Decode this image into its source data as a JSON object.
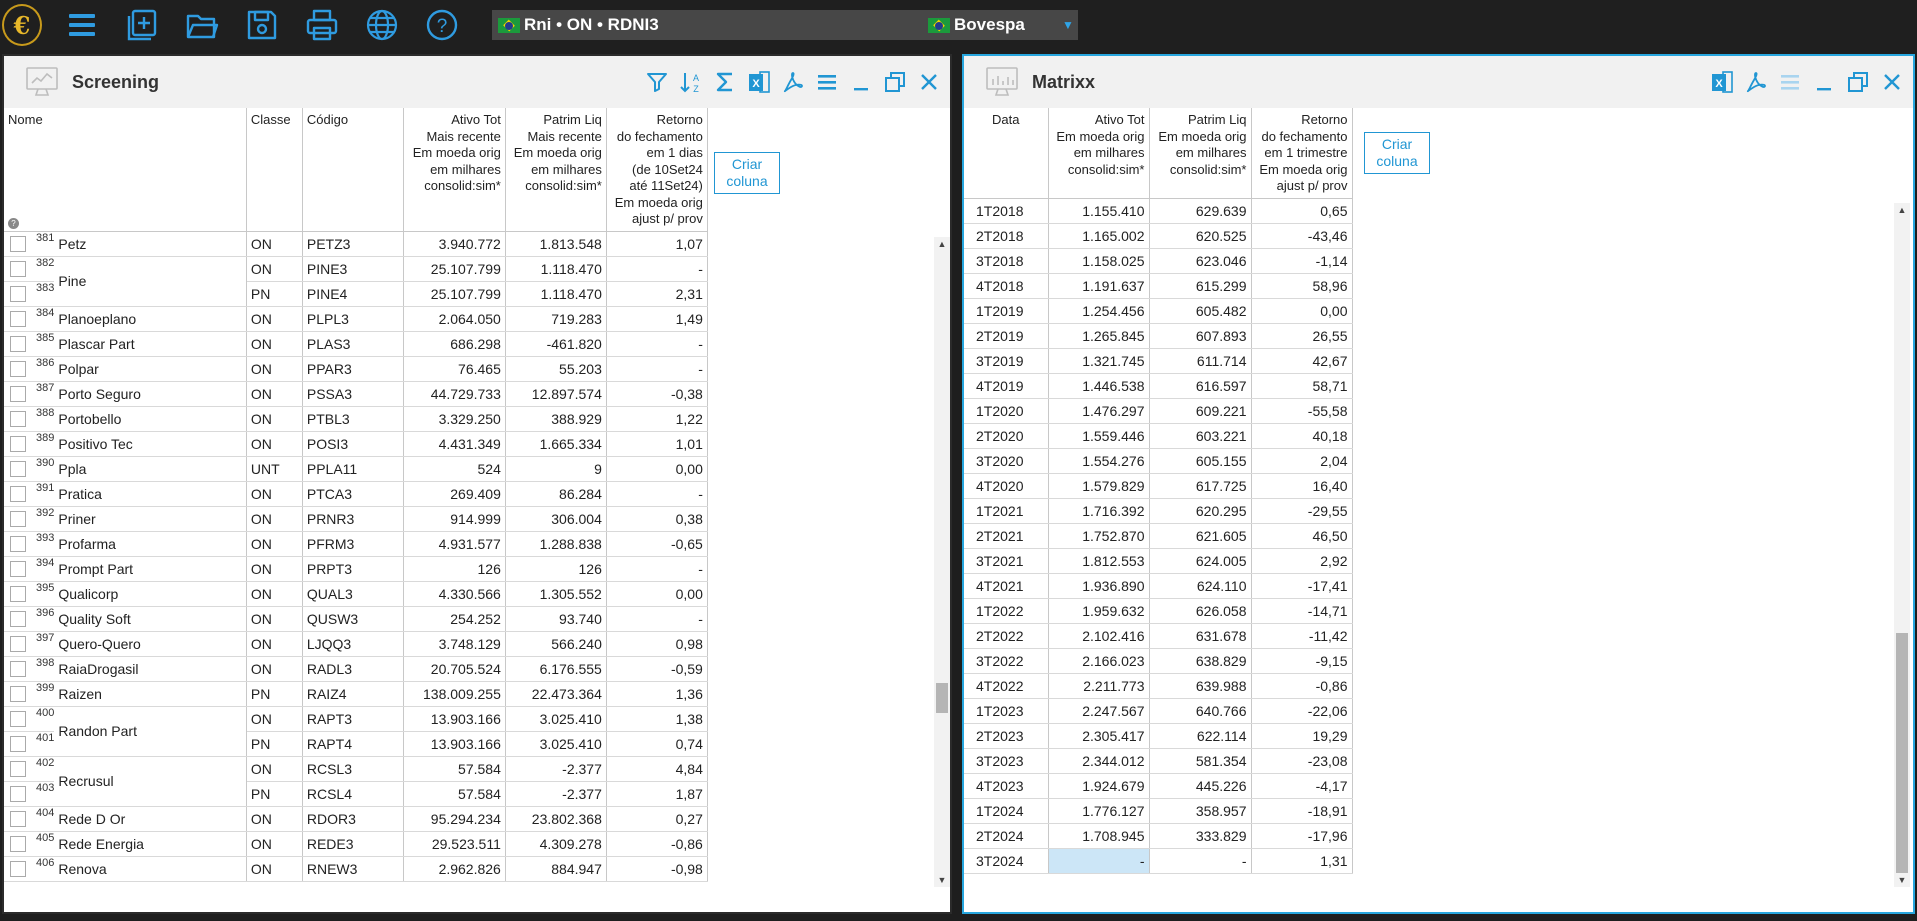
{
  "toolbar": {
    "logo_glyph": "€",
    "buttons": [
      "menu-icon",
      "new-icon",
      "open-folder-icon",
      "save-icon",
      "print-icon",
      "globe-icon",
      "help-icon"
    ],
    "asset_label": "Rni • ON • RDNI3",
    "exchange_label": "Bovespa",
    "dropdown_glyph": "▼"
  },
  "screening": {
    "title": "Screening",
    "create_column": [
      "Criar",
      "coluna"
    ],
    "columns": {
      "nome": "Nome",
      "classe": "Classe",
      "codigo": "Código",
      "ativo": [
        "Ativo Tot",
        "Mais recente",
        "Em moeda orig",
        "em milhares",
        "consolid:sim*"
      ],
      "patrim": [
        "Patrim Liq",
        "Mais recente",
        "Em moeda orig",
        "em milhares",
        "consolid:sim*"
      ],
      "retorno": [
        "Retorno",
        "do fechamento",
        "em 1 dias",
        "(de 10Set24",
        "até 11Set24)",
        "Em moeda orig",
        "ajust p/ prov"
      ]
    },
    "help_glyph": "?",
    "rows": [
      {
        "idx": "381",
        "name": "Petz",
        "span": 1,
        "classe": "ON",
        "codigo": "PETZ3",
        "ativo": "3.940.772",
        "patrim": "1.813.548",
        "ret": "1,07"
      },
      {
        "idx": "382",
        "name": "Pine",
        "span": 2,
        "classe": "ON",
        "codigo": "PINE3",
        "ativo": "25.107.799",
        "patrim": "1.118.470",
        "ret": "-"
      },
      {
        "idx": "383",
        "name": "",
        "span": 0,
        "classe": "PN",
        "codigo": "PINE4",
        "ativo": "25.107.799",
        "patrim": "1.118.470",
        "ret": "2,31"
      },
      {
        "idx": "384",
        "name": "Planoeplano",
        "span": 1,
        "classe": "ON",
        "codigo": "PLPL3",
        "ativo": "2.064.050",
        "patrim": "719.283",
        "ret": "1,49"
      },
      {
        "idx": "385",
        "name": "Plascar Part",
        "span": 1,
        "classe": "ON",
        "codigo": "PLAS3",
        "ativo": "686.298",
        "patrim": "-461.820",
        "ret": "-"
      },
      {
        "idx": "386",
        "name": "Polpar",
        "span": 1,
        "classe": "ON",
        "codigo": "PPAR3",
        "ativo": "76.465",
        "patrim": "55.203",
        "ret": "-"
      },
      {
        "idx": "387",
        "name": "Porto Seguro",
        "span": 1,
        "classe": "ON",
        "codigo": "PSSA3",
        "ativo": "44.729.733",
        "patrim": "12.897.574",
        "ret": "-0,38"
      },
      {
        "idx": "388",
        "name": "Portobello",
        "span": 1,
        "classe": "ON",
        "codigo": "PTBL3",
        "ativo": "3.329.250",
        "patrim": "388.929",
        "ret": "1,22"
      },
      {
        "idx": "389",
        "name": "Positivo Tec",
        "span": 1,
        "classe": "ON",
        "codigo": "POSI3",
        "ativo": "4.431.349",
        "patrim": "1.665.334",
        "ret": "1,01"
      },
      {
        "idx": "390",
        "name": "Ppla",
        "span": 1,
        "classe": "UNT",
        "codigo": "PPLA11",
        "ativo": "524",
        "patrim": "9",
        "ret": "0,00"
      },
      {
        "idx": "391",
        "name": "Pratica",
        "span": 1,
        "classe": "ON",
        "codigo": "PTCA3",
        "ativo": "269.409",
        "patrim": "86.284",
        "ret": "-"
      },
      {
        "idx": "392",
        "name": "Priner",
        "span": 1,
        "classe": "ON",
        "codigo": "PRNR3",
        "ativo": "914.999",
        "patrim": "306.004",
        "ret": "0,38"
      },
      {
        "idx": "393",
        "name": "Profarma",
        "span": 1,
        "classe": "ON",
        "codigo": "PFRM3",
        "ativo": "4.931.577",
        "patrim": "1.288.838",
        "ret": "-0,65"
      },
      {
        "idx": "394",
        "name": "Prompt Part",
        "span": 1,
        "classe": "ON",
        "codigo": "PRPT3",
        "ativo": "126",
        "patrim": "126",
        "ret": "-"
      },
      {
        "idx": "395",
        "name": "Qualicorp",
        "span": 1,
        "classe": "ON",
        "codigo": "QUAL3",
        "ativo": "4.330.566",
        "patrim": "1.305.552",
        "ret": "0,00"
      },
      {
        "idx": "396",
        "name": "Quality Soft",
        "span": 1,
        "classe": "ON",
        "codigo": "QUSW3",
        "ativo": "254.252",
        "patrim": "93.740",
        "ret": "-"
      },
      {
        "idx": "397",
        "name": "Quero-Quero",
        "span": 1,
        "classe": "ON",
        "codigo": "LJQQ3",
        "ativo": "3.748.129",
        "patrim": "566.240",
        "ret": "0,98"
      },
      {
        "idx": "398",
        "name": "RaiaDrogasil",
        "span": 1,
        "classe": "ON",
        "codigo": "RADL3",
        "ativo": "20.705.524",
        "patrim": "6.176.555",
        "ret": "-0,59"
      },
      {
        "idx": "399",
        "name": "Raizen",
        "span": 1,
        "classe": "PN",
        "codigo": "RAIZ4",
        "ativo": "138.009.255",
        "patrim": "22.473.364",
        "ret": "1,36"
      },
      {
        "idx": "400",
        "name": "Randon Part",
        "span": 2,
        "classe": "ON",
        "codigo": "RAPT3",
        "ativo": "13.903.166",
        "patrim": "3.025.410",
        "ret": "1,38"
      },
      {
        "idx": "401",
        "name": "",
        "span": 0,
        "classe": "PN",
        "codigo": "RAPT4",
        "ativo": "13.903.166",
        "patrim": "3.025.410",
        "ret": "0,74"
      },
      {
        "idx": "402",
        "name": "Recrusul",
        "span": 2,
        "classe": "ON",
        "codigo": "RCSL3",
        "ativo": "57.584",
        "patrim": "-2.377",
        "ret": "4,84"
      },
      {
        "idx": "403",
        "name": "",
        "span": 0,
        "classe": "PN",
        "codigo": "RCSL4",
        "ativo": "57.584",
        "patrim": "-2.377",
        "ret": "1,87"
      },
      {
        "idx": "404",
        "name": "Rede D Or",
        "span": 1,
        "classe": "ON",
        "codigo": "RDOR3",
        "ativo": "95.294.234",
        "patrim": "23.802.368",
        "ret": "0,27"
      },
      {
        "idx": "405",
        "name": "Rede Energia",
        "span": 1,
        "classe": "ON",
        "codigo": "REDE3",
        "ativo": "29.523.511",
        "patrim": "4.309.278",
        "ret": "-0,86"
      },
      {
        "idx": "406",
        "name": "Renova",
        "span": 1,
        "classe": "ON",
        "codigo": "RNEW3",
        "ativo": "2.962.826",
        "patrim": "884.947",
        "ret": "-0,98"
      }
    ],
    "scroll_position": 0.73
  },
  "matrixx": {
    "title": "Matrixx",
    "create_column": [
      "Criar",
      "coluna"
    ],
    "columns": {
      "data": "Data",
      "ativo": [
        "Ativo Tot",
        "Em moeda orig",
        "em milhares",
        "consolid:sim*"
      ],
      "patrim": [
        "Patrim Liq",
        "Em moeda orig",
        "em milhares",
        "consolid:sim*"
      ],
      "retorno": [
        "Retorno",
        "do fechamento",
        "em 1 trimestre",
        "Em moeda orig",
        "ajust p/ prov"
      ]
    },
    "rows": [
      {
        "d": "1T2018",
        "a": "1.155.410",
        "p": "629.639",
        "r": "0,65"
      },
      {
        "d": "2T2018",
        "a": "1.165.002",
        "p": "620.525",
        "r": "-43,46"
      },
      {
        "d": "3T2018",
        "a": "1.158.025",
        "p": "623.046",
        "r": "-1,14"
      },
      {
        "d": "4T2018",
        "a": "1.191.637",
        "p": "615.299",
        "r": "58,96"
      },
      {
        "d": "1T2019",
        "a": "1.254.456",
        "p": "605.482",
        "r": "0,00"
      },
      {
        "d": "2T2019",
        "a": "1.265.845",
        "p": "607.893",
        "r": "26,55"
      },
      {
        "d": "3T2019",
        "a": "1.321.745",
        "p": "611.714",
        "r": "42,67"
      },
      {
        "d": "4T2019",
        "a": "1.446.538",
        "p": "616.597",
        "r": "58,71"
      },
      {
        "d": "1T2020",
        "a": "1.476.297",
        "p": "609.221",
        "r": "-55,58"
      },
      {
        "d": "2T2020",
        "a": "1.559.446",
        "p": "603.221",
        "r": "40,18"
      },
      {
        "d": "3T2020",
        "a": "1.554.276",
        "p": "605.155",
        "r": "2,04"
      },
      {
        "d": "4T2020",
        "a": "1.579.829",
        "p": "617.725",
        "r": "16,40"
      },
      {
        "d": "1T2021",
        "a": "1.716.392",
        "p": "620.295",
        "r": "-29,55"
      },
      {
        "d": "2T2021",
        "a": "1.752.870",
        "p": "621.605",
        "r": "46,50"
      },
      {
        "d": "3T2021",
        "a": "1.812.553",
        "p": "624.005",
        "r": "2,92"
      },
      {
        "d": "4T2021",
        "a": "1.936.890",
        "p": "624.110",
        "r": "-17,41"
      },
      {
        "d": "1T2022",
        "a": "1.959.632",
        "p": "626.058",
        "r": "-14,71"
      },
      {
        "d": "2T2022",
        "a": "2.102.416",
        "p": "631.678",
        "r": "-11,42"
      },
      {
        "d": "3T2022",
        "a": "2.166.023",
        "p": "638.829",
        "r": "-9,15"
      },
      {
        "d": "4T2022",
        "a": "2.211.773",
        "p": "639.988",
        "r": "-0,86"
      },
      {
        "d": "1T2023",
        "a": "2.247.567",
        "p": "640.766",
        "r": "-22,06"
      },
      {
        "d": "2T2023",
        "a": "2.305.417",
        "p": "622.114",
        "r": "19,29"
      },
      {
        "d": "3T2023",
        "a": "2.344.012",
        "p": "581.354",
        "r": "-23,08"
      },
      {
        "d": "4T2023",
        "a": "1.924.679",
        "p": "445.226",
        "r": "-4,17"
      },
      {
        "d": "1T2024",
        "a": "1.776.127",
        "p": "358.957",
        "r": "-18,91"
      },
      {
        "d": "2T2024",
        "a": "1.708.945",
        "p": "333.829",
        "r": "-17,96"
      },
      {
        "d": "3T2024",
        "a": "-",
        "p": "-",
        "r": "1,31",
        "selected": true
      }
    ],
    "scroll_position": 1.0
  },
  "colors": {
    "accent": "#2196d3",
    "active_border": "#27a6de",
    "selected_cell": "#cce6f7"
  }
}
